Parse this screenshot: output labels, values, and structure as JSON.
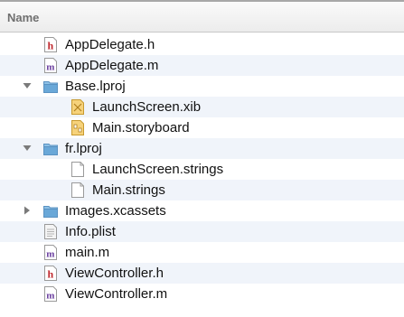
{
  "header": {
    "name_label": "Name"
  },
  "files": [
    {
      "label": "AppDelegate.h",
      "icon": "header-file-icon",
      "level": 0
    },
    {
      "label": "AppDelegate.m",
      "icon": "objc-file-icon",
      "level": 0
    },
    {
      "label": "Base.lproj",
      "icon": "folder-icon",
      "level": 0,
      "expanded": true
    },
    {
      "label": "LaunchScreen.xib",
      "icon": "xib-file-icon",
      "level": 1
    },
    {
      "label": "Main.storyboard",
      "icon": "storyboard-file-icon",
      "level": 1
    },
    {
      "label": "fr.lproj",
      "icon": "folder-icon",
      "level": 0,
      "expanded": true
    },
    {
      "label": "LaunchScreen.strings",
      "icon": "blank-file-icon",
      "level": 1
    },
    {
      "label": "Main.strings",
      "icon": "blank-file-icon",
      "level": 1
    },
    {
      "label": "Images.xcassets",
      "icon": "asset-folder-icon",
      "level": 0,
      "expanded": false
    },
    {
      "label": "Info.plist",
      "icon": "plist-file-icon",
      "level": 0
    },
    {
      "label": "main.m",
      "icon": "objc-file-icon",
      "level": 0
    },
    {
      "label": "ViewController.h",
      "icon": "header-file-icon",
      "level": 0
    },
    {
      "label": "ViewController.m",
      "icon": "objc-file-icon",
      "level": 0
    }
  ],
  "colors": {
    "header_letter": "#c0282e",
    "objc_letter": "#6b3fa0",
    "folder": "#6aa8d8",
    "xib": "#e8b23a"
  }
}
